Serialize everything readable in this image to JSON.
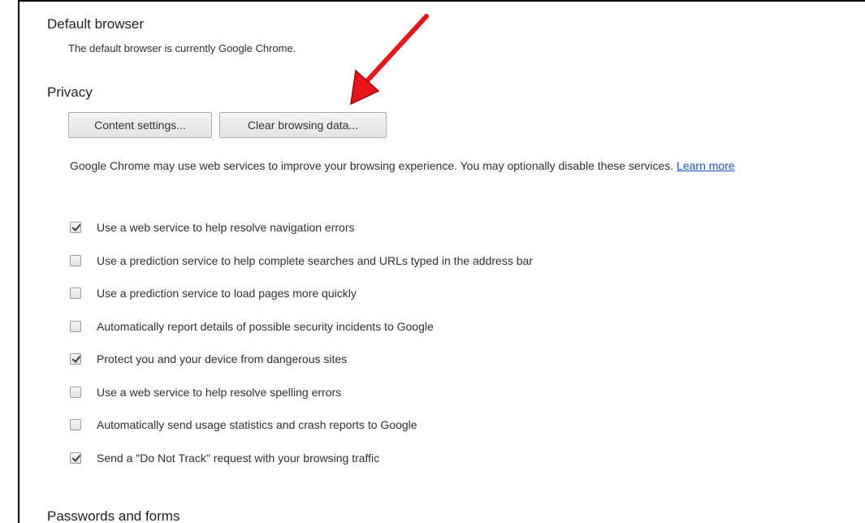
{
  "sections": {
    "default_browser": {
      "title": "Default browser",
      "description": "The default browser is currently Google Chrome."
    },
    "privacy": {
      "title": "Privacy",
      "content_settings_label": "Content settings...",
      "clear_browsing_data_label": "Clear browsing data...",
      "info_text": "Google Chrome may use web services to improve your browsing experience. You may optionally disable these services.",
      "learn_more": "Learn more",
      "options": [
        {
          "label": "Use a web service to help resolve navigation errors",
          "checked": true
        },
        {
          "label": "Use a prediction service to help complete searches and URLs typed in the address bar",
          "checked": false
        },
        {
          "label": "Use a prediction service to load pages more quickly",
          "checked": false
        },
        {
          "label": "Automatically report details of possible security incidents to Google",
          "checked": false
        },
        {
          "label": "Protect you and your device from dangerous sites",
          "checked": true
        },
        {
          "label": "Use a web service to help resolve spelling errors",
          "checked": false
        },
        {
          "label": "Automatically send usage statistics and crash reports to Google",
          "checked": false
        },
        {
          "label": "Send a \"Do Not Track\" request with your browsing traffic",
          "checked": true
        }
      ]
    },
    "passwords": {
      "title": "Passwords and forms"
    }
  },
  "colors": {
    "link": "#1a55c4",
    "annotation_arrow": "#e8161b"
  }
}
